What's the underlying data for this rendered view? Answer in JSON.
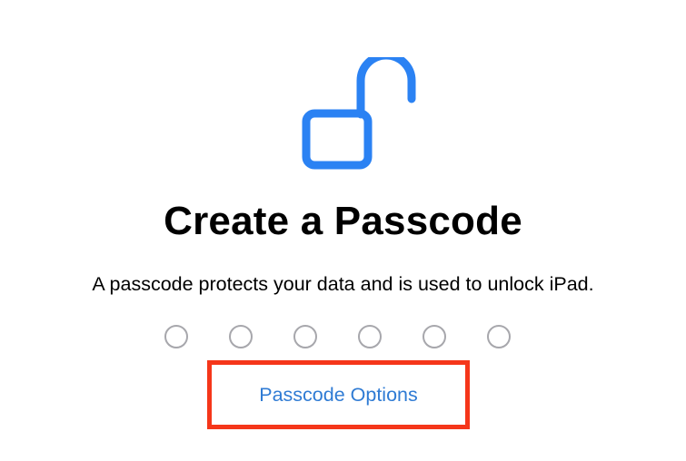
{
  "lock": {
    "icon": "unlocked-padlock-icon",
    "color": "#2b82f3"
  },
  "title": "Create a Passcode",
  "subtitle": "A passcode protects your data and is used to unlock iPad.",
  "passcode": {
    "length": 6,
    "entered": 0
  },
  "options_link": {
    "label": "Passcode Options",
    "color": "#2f7bd4"
  },
  "annotation": {
    "color": "#f5361a"
  }
}
